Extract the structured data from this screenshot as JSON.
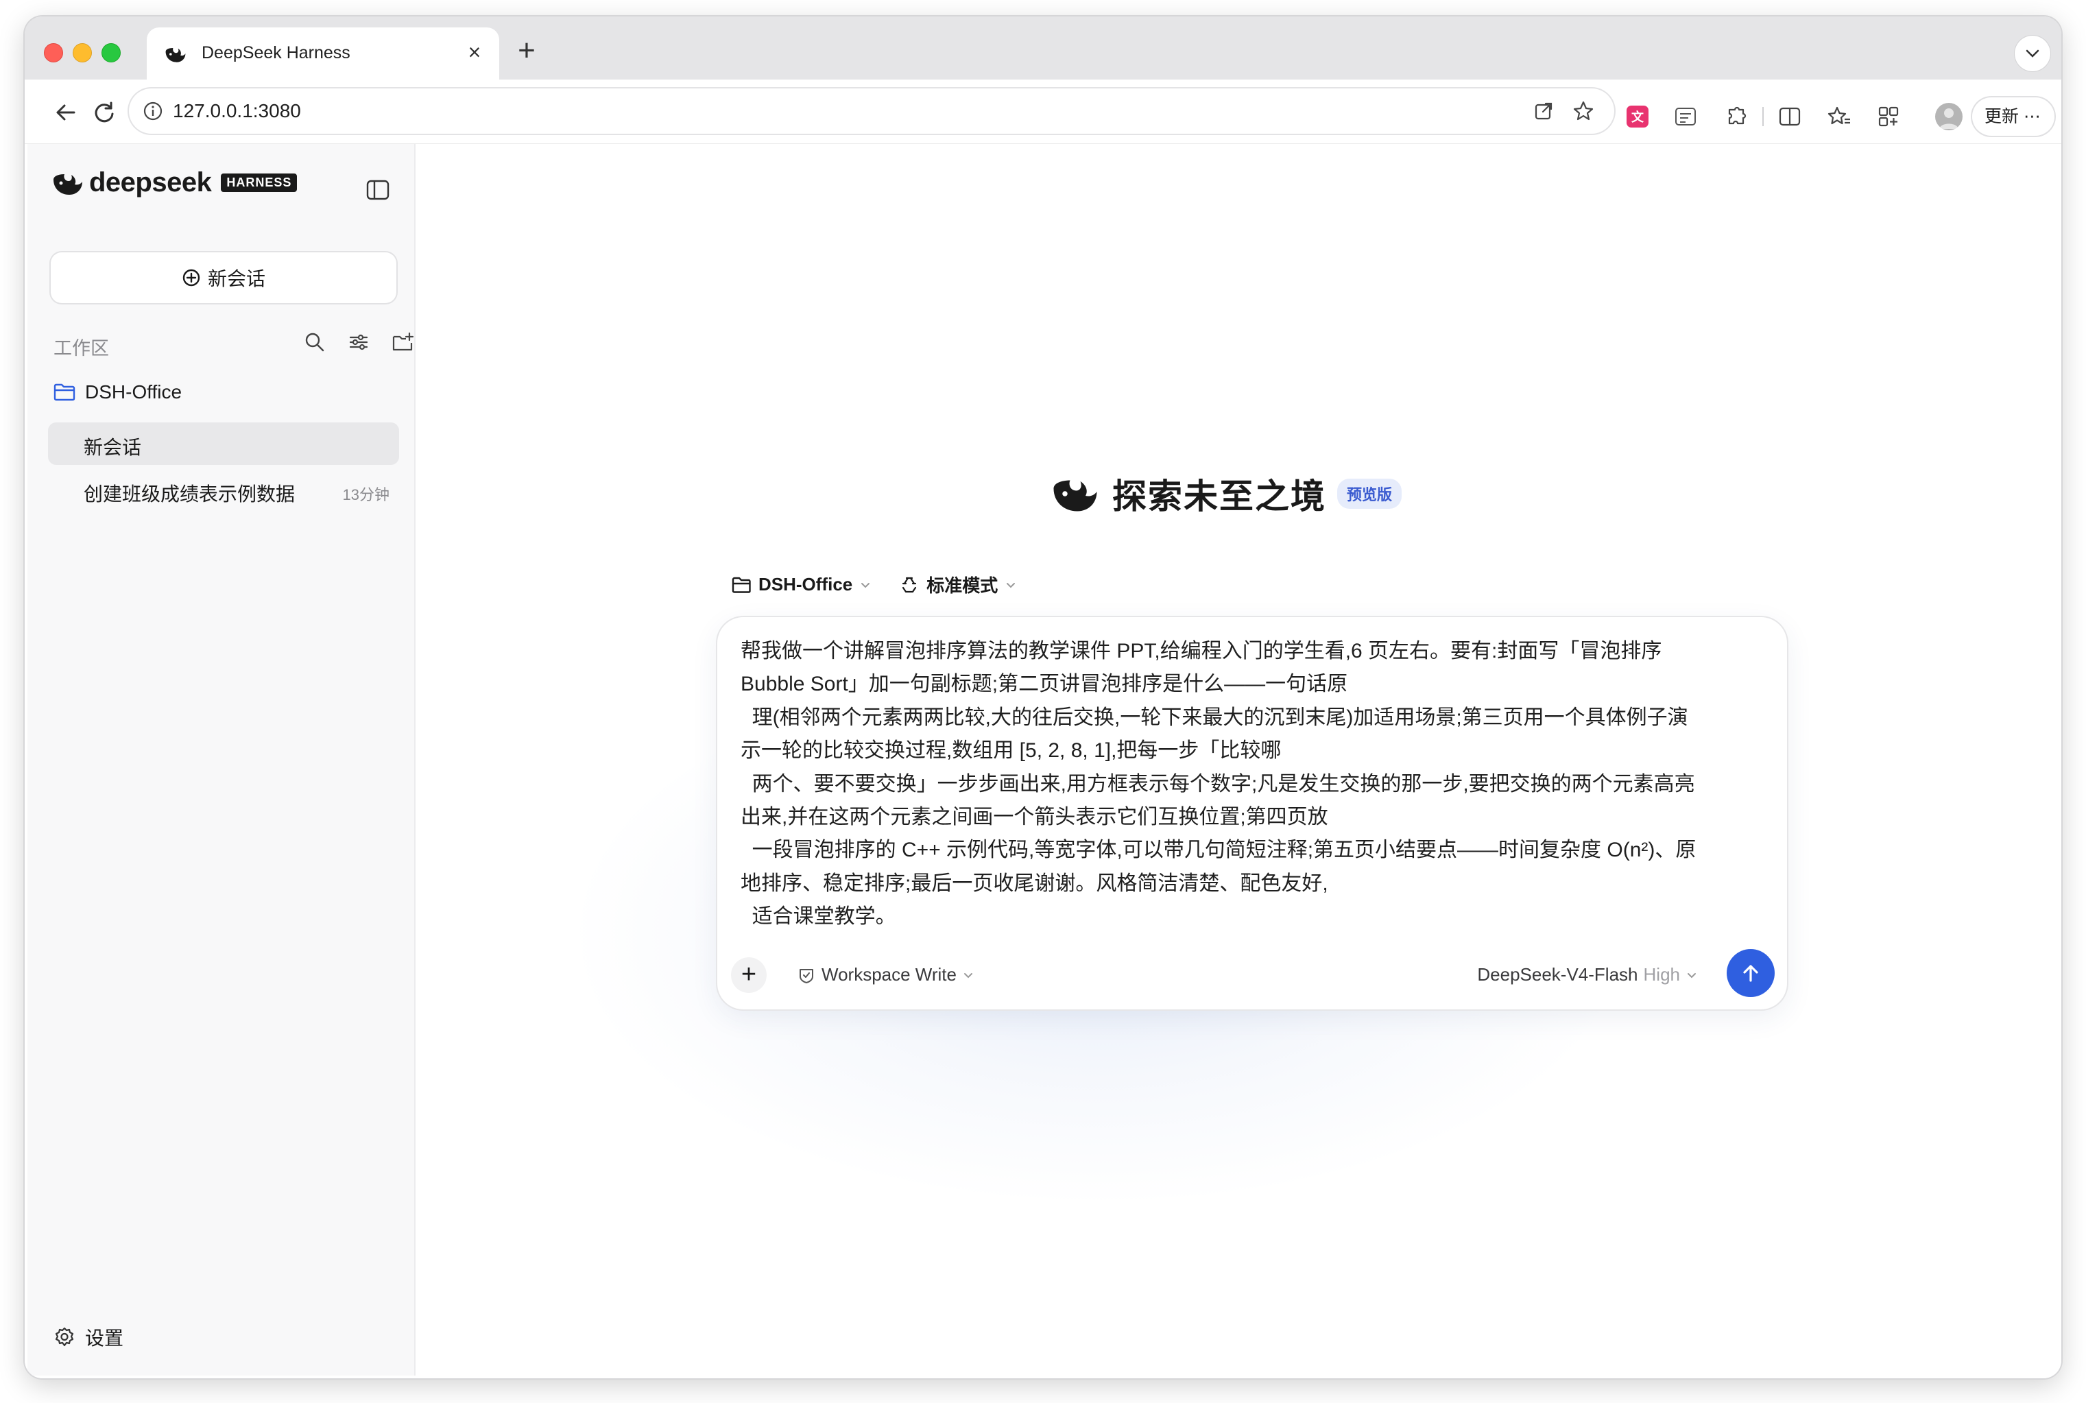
{
  "browser": {
    "tab_title": "DeepSeek Harness",
    "tab_close": "×",
    "new_tab": "+",
    "url": "127.0.0.1:3080",
    "update_label": "更新 ⋯"
  },
  "sidebar": {
    "logo_text": "deepseek",
    "logo_badge": "HARNESS",
    "new_chat_label": "新会话",
    "workspace_label": "工作区",
    "folder_name": "DSH-Office",
    "sessions": [
      {
        "title": "新会话",
        "time": ""
      },
      {
        "title": "创建班级成绩表示例数据",
        "time": "13分钟"
      }
    ],
    "settings_label": "设置"
  },
  "main": {
    "hero_title": "探索未至之境",
    "hero_badge": "预览版",
    "folder_selector": "DSH-Office",
    "mode_selector": "标准模式",
    "composer_text": "帮我做一个讲解冒泡排序算法的教学课件 PPT,给编程入门的学生看,6 页左右。要有:封面写「冒泡排序\nBubble Sort」加一句副标题;第二页讲冒泡排序是什么——一句话原\n  理(相邻两个元素两两比较,大的往后交换,一轮下来最大的沉到末尾)加适用场景;第三页用一个具体例子演\n示一轮的比较交换过程,数组用 [5, 2, 8, 1],把每一步「比较哪\n  两个、要不要交换」一步步画出来,用方框表示每个数字;凡是发生交换的那一步,要把交换的两个元素高亮\n出来,并在这两个元素之间画一个箭头表示它们互换位置;第四页放\n  一段冒泡排序的 C++ 示例代码,等宽字体,可以带几句简短注释;第五页小结要点——时间复杂度 O(n²)、原\n地排序、稳定排序;最后一页收尾谢谢。风格简洁清楚、配色友好,\n  适合课堂教学。",
    "attach_label": "+",
    "permission_mode": "Workspace Write",
    "model_name": "DeepSeek-V4-Flash",
    "model_level": "High"
  },
  "colors": {
    "accent": "#2f5fe0",
    "badge_bg": "#e6ecfb",
    "badge_text": "#3a5bd0",
    "sidebar_bg": "#f8f8f9"
  }
}
